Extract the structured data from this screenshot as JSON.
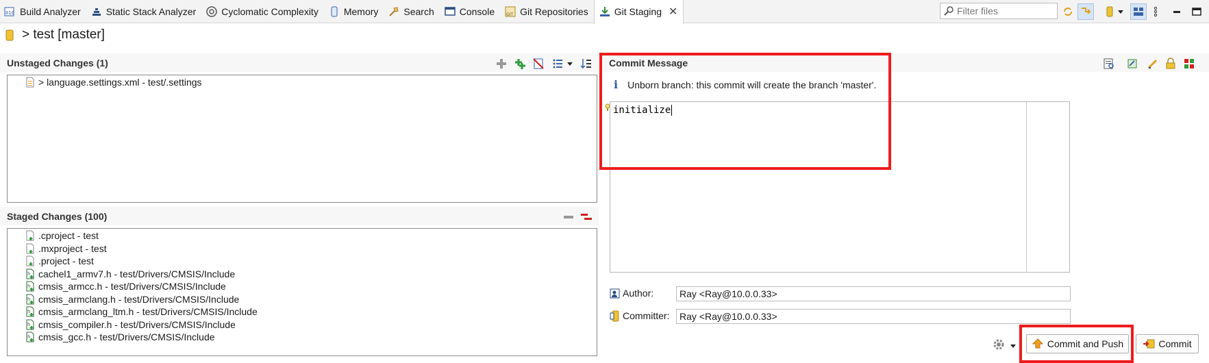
{
  "tabs": [
    {
      "label": "Build Analyzer",
      "icon": "build-analyzer-icon"
    },
    {
      "label": "Static Stack Analyzer",
      "icon": "stack-analyzer-icon"
    },
    {
      "label": "Cyclomatic Complexity",
      "icon": "complexity-icon"
    },
    {
      "label": "Memory",
      "icon": "memory-icon"
    },
    {
      "label": "Search",
      "icon": "search-icon"
    },
    {
      "label": "Console",
      "icon": "console-icon"
    },
    {
      "label": "Git Repositories",
      "icon": "git-repositories-icon"
    },
    {
      "label": "Git Staging",
      "icon": "git-staging-icon"
    }
  ],
  "filter": {
    "placeholder": "Filter files"
  },
  "repo": {
    "title": "> test [master]"
  },
  "unstaged": {
    "title": "Unstaged Changes (1)",
    "items": [
      "> language.settings.xml - test/.settings"
    ]
  },
  "staged": {
    "title": "Staged Changes (100)",
    "items": [
      ".cproject - test",
      ".mxproject - test",
      ".project - test",
      "cachel1_armv7.h - test/Drivers/CMSIS/Include",
      "cmsis_armcc.h - test/Drivers/CMSIS/Include",
      "cmsis_armclang.h - test/Drivers/CMSIS/Include",
      "cmsis_armclang_ltm.h - test/Drivers/CMSIS/Include",
      "cmsis_compiler.h - test/Drivers/CMSIS/Include",
      "cmsis_gcc.h - test/Drivers/CMSIS/Include"
    ]
  },
  "commit": {
    "title": "Commit Message",
    "info": "Unborn branch: this commit will create the branch 'master'.",
    "message": "initialize",
    "author_label": "Author:",
    "author_value": "Ray <Ray@10.0.0.33>",
    "committer_label": "Committer:",
    "committer_value": "Ray <Ray@10.0.0.33>",
    "commit_and_push_label": "Commit and Push",
    "commit_label": "Commit"
  },
  "colors": {
    "highlight": "#ee1c1c",
    "selection": "#d6e4f5"
  }
}
